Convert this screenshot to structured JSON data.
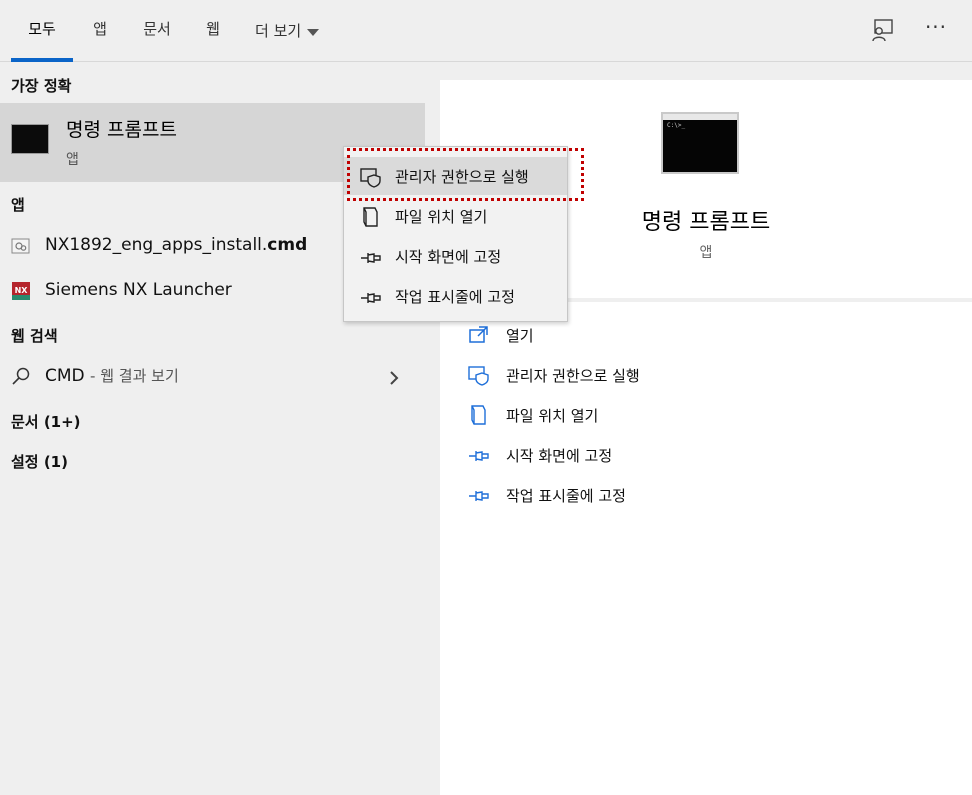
{
  "tabs": {
    "all": "모두",
    "apps": "앱",
    "documents": "문서",
    "web": "웹",
    "more": "더 보기"
  },
  "top_icons": {
    "feedback": "feedback-icon",
    "more": "···"
  },
  "left": {
    "best_match_header": "가장 정확",
    "best_match": {
      "title": "명령 프롬프트",
      "subtitle": "앱",
      "icon": "command-prompt-icon"
    },
    "apps_header": "앱",
    "apps": [
      {
        "name_prefix": "NX1892_eng_apps_install.",
        "name_bold": "cmd",
        "icon": "cmd-file-icon"
      },
      {
        "name_prefix": "Siemens NX Launcher",
        "name_bold": "",
        "icon": "nx-icon",
        "icon_text": "NX"
      }
    ],
    "web_header": "웹 검색",
    "web_search": {
      "query": "CMD",
      "hint": "- 웹 결과 보기",
      "icon": "search-icon"
    },
    "documents": "문서 (1+)",
    "settings": "설정 (1)"
  },
  "right": {
    "title": "명령 프롬프트",
    "subtitle": "앱",
    "prompt_text": "C:\\>_",
    "actions": [
      {
        "label": "열기",
        "icon": "open-icon"
      },
      {
        "label": "관리자 권한으로 실행",
        "icon": "shield-icon"
      },
      {
        "label": "파일 위치 열기",
        "icon": "folder-icon"
      },
      {
        "label": "시작 화면에 고정",
        "icon": "pin-icon"
      },
      {
        "label": "작업 표시줄에 고정",
        "icon": "pin-icon"
      }
    ]
  },
  "context_menu": {
    "items": [
      {
        "label": "관리자 권한으로 실행",
        "icon": "shield-icon",
        "hovered": true
      },
      {
        "label": "파일 위치 열기",
        "icon": "folder-icon"
      },
      {
        "label": "시작 화면에 고정",
        "icon": "pin-icon"
      },
      {
        "label": "작업 표시줄에 고정",
        "icon": "pin-icon"
      }
    ]
  },
  "colors": {
    "accent": "#0a64c8",
    "icon_blue": "#1e6fd9",
    "highlight": "#c00000",
    "nx_red": "#b5242c"
  }
}
